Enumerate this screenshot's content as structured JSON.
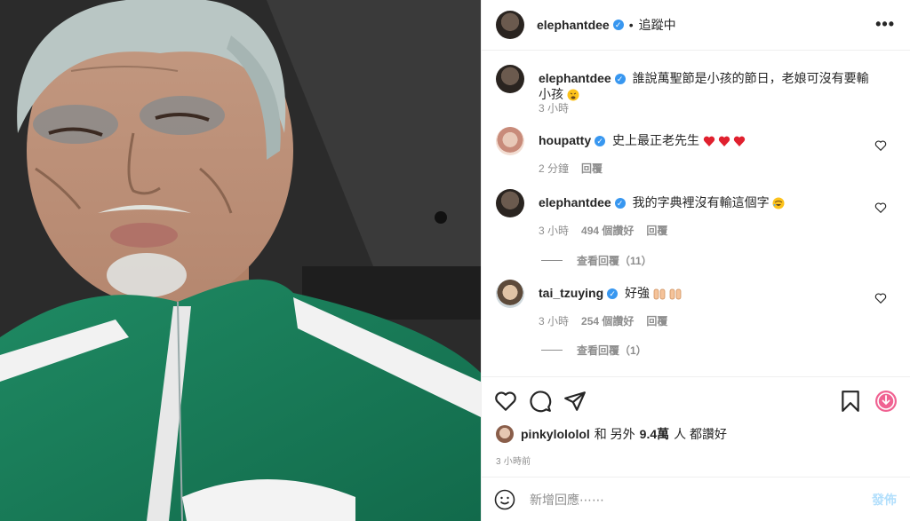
{
  "post": {
    "owner": "elephantdee",
    "follow_status": "追蹤中",
    "more_symbol": "•••"
  },
  "comments": [
    {
      "user": "elephantdee",
      "text": "誰說萬聖節是小孩的節日，老娘可沒有要輸小孩",
      "time": "3 小時",
      "emoji": "tired-face-icon"
    },
    {
      "user": "houpatty",
      "text": "史上最正老先生",
      "time": "2 分鐘",
      "reply": "回覆",
      "emoji": "heart-red-icon"
    },
    {
      "user": "elephantdee",
      "text": "我的字典裡沒有輸這個字",
      "time": "3 小時",
      "likes": "494 個讚好",
      "reply": "回覆",
      "view_replies": "查看回覆（11）",
      "emoji": "rofl-icon"
    },
    {
      "user": "tai_tzuying",
      "text": "好強",
      "time": "3 小時",
      "likes": "254 個讚好",
      "reply": "回覆",
      "view_replies": "查看回覆（1）",
      "emoji": "raising-hands-icon"
    }
  ],
  "likes": {
    "user": "pinkylololol",
    "conj": "和 另外",
    "count": "9.4萬",
    "suffix": "人 都讚好"
  },
  "posted_time": "3 小時前",
  "add_comment": {
    "placeholder": "新增回應⋯⋯",
    "post_label": "發佈"
  },
  "colors": {
    "verified": "#3897f0",
    "heart": "#ed4956",
    "muted": "#8e8e8e",
    "post_disabled": "#b2dffc"
  }
}
